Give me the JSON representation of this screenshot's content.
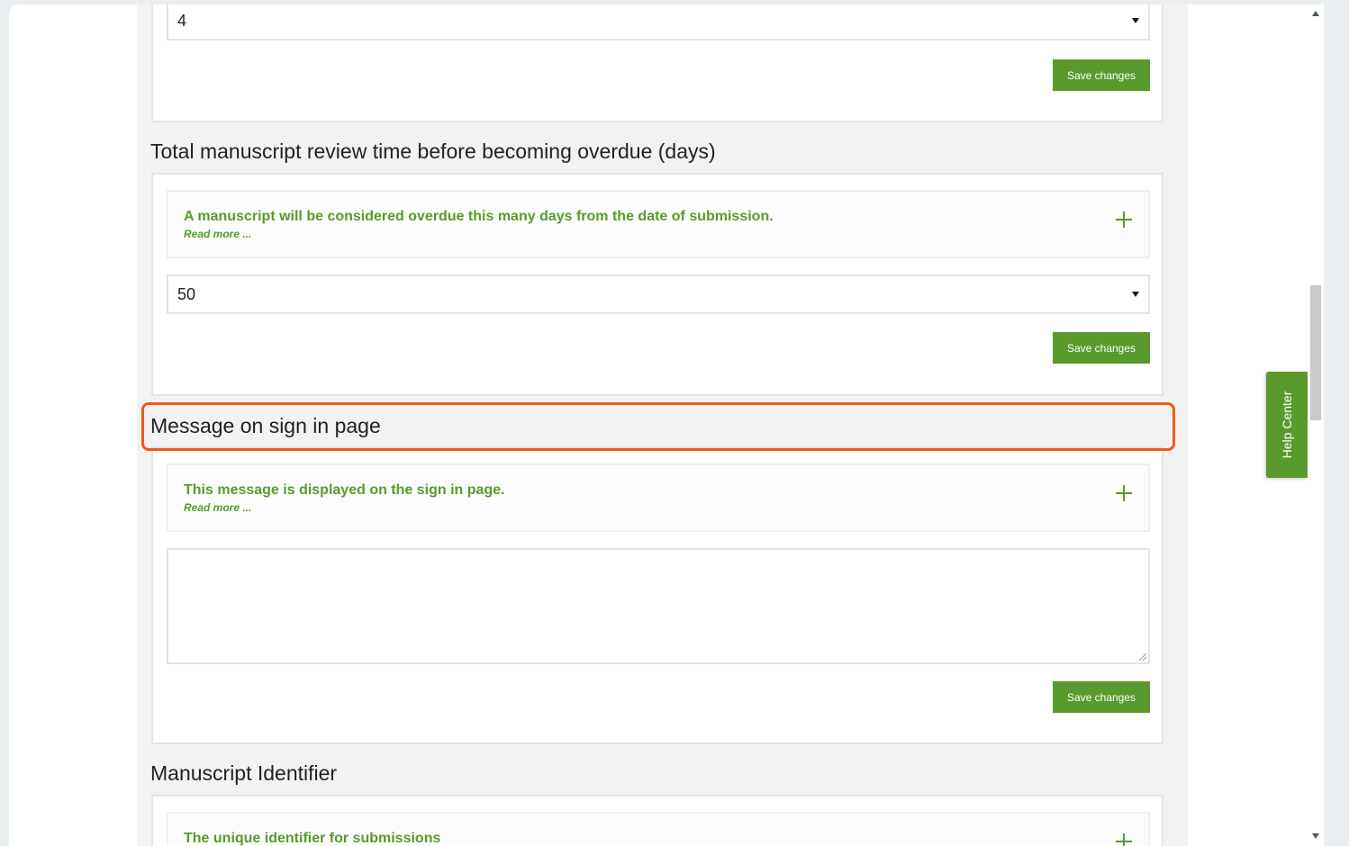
{
  "sections": [
    {
      "select_value": "4",
      "save_label": "Save changes"
    },
    {
      "title": "Total manuscript review time before becoming overdue (days)",
      "info_text": "A manuscript will be considered overdue this many days from the date of submission.",
      "read_more": "Read more ...",
      "select_value": "50",
      "save_label": "Save changes"
    },
    {
      "title": "Message on sign in page",
      "info_text": "This message is displayed on the sign in page.",
      "read_more": "Read more ...",
      "textarea_value": "",
      "save_label": "Save changes"
    },
    {
      "title": "Manuscript Identifier",
      "info_text": "The unique identifier for submissions"
    }
  ],
  "help_center": {
    "label": "Help Center"
  },
  "colors": {
    "accent_green": "#5a9a2c",
    "highlight_orange": "#f05a14"
  }
}
